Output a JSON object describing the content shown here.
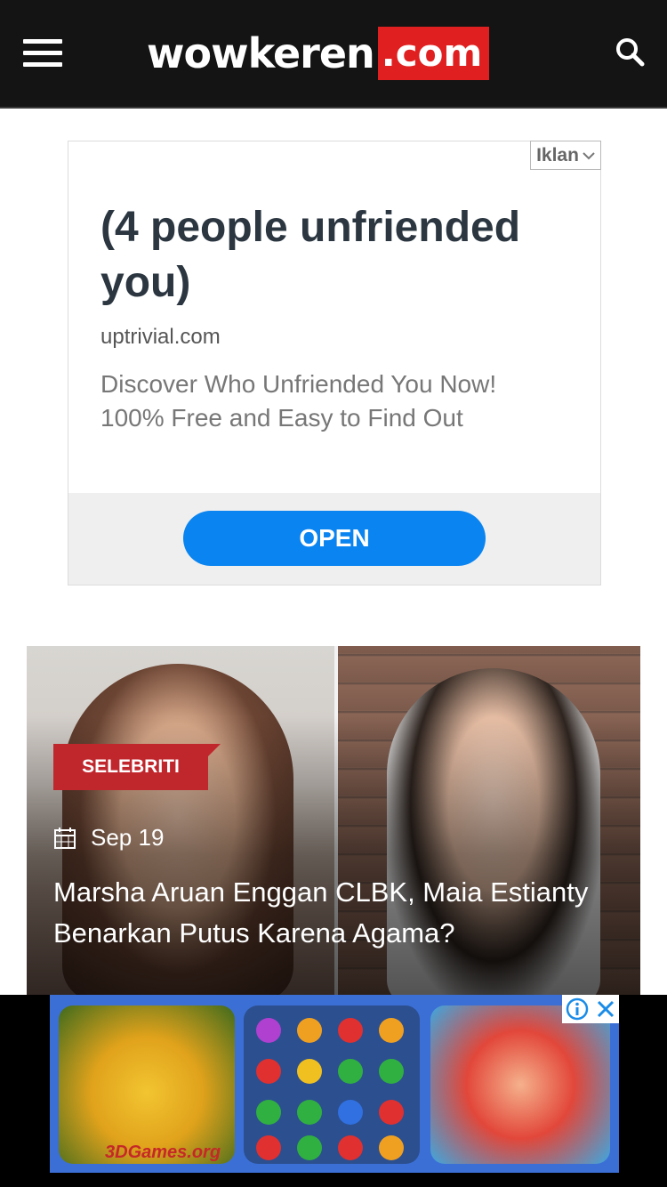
{
  "header": {
    "logo_word": "wowkeren",
    "logo_domain": ".com"
  },
  "ad": {
    "label": "Iklan",
    "headline": "(4 people unfriended you)",
    "domain": "uptrivial.com",
    "description": "Discover Who Unfriended You Now! 100% Free and Easy to Find Out",
    "cta": "OPEN"
  },
  "article": {
    "category": "SELEBRITI",
    "date": "Sep 19",
    "title": "Marsha Aruan Enggan CLBK, Maia Estianty Benarkan Putus Karena Agama?"
  },
  "bottom_ad": {
    "brand": "3DGames.org"
  },
  "colors": {
    "header_bg": "#141414",
    "logo_accent": "#e02020",
    "cta_blue": "#0a84f0",
    "category_red": "#c0272d"
  }
}
